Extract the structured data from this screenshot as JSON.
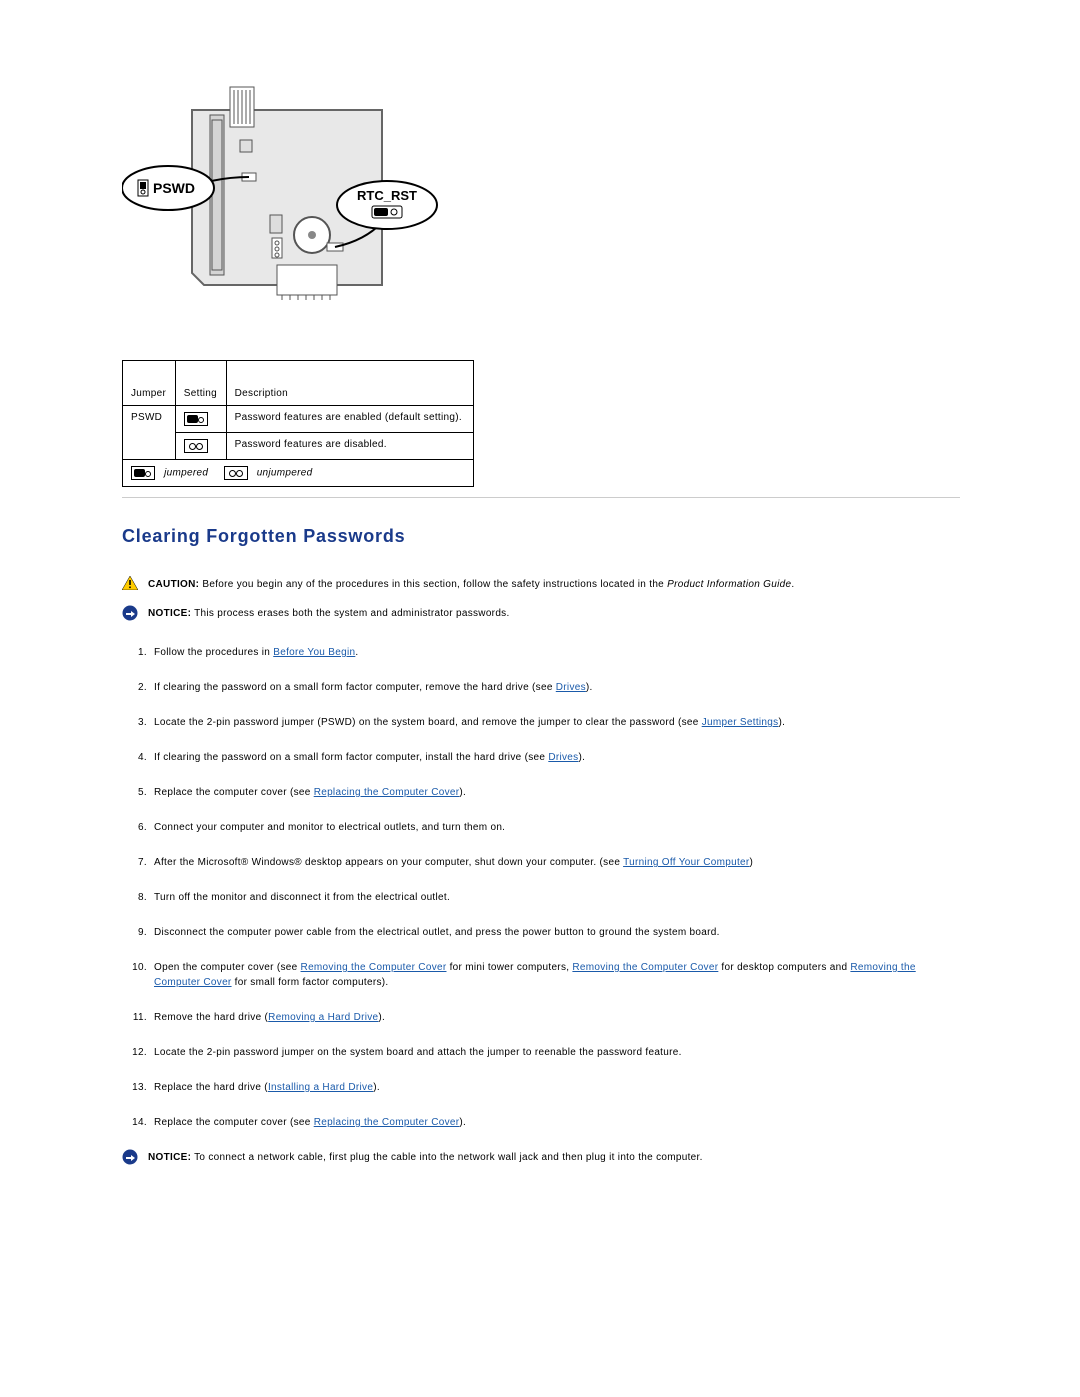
{
  "diagram": {
    "label_pswd": "PSWD",
    "label_rtcrst": "RTC_RST"
  },
  "table": {
    "headers": {
      "jumper": "Jumper",
      "setting": "Setting",
      "description": "Description"
    },
    "rows": [
      {
        "jumper": "PSWD",
        "setting_type": "jumpered",
        "description": "Password features are enabled (default setting)."
      },
      {
        "jumper": "",
        "setting_type": "unjumpered",
        "description": "Password features are disabled."
      }
    ],
    "legend": {
      "jumpered": "jumpered",
      "unjumpered": "unjumpered"
    }
  },
  "section_title": "Clearing Forgotten Passwords",
  "caution": {
    "label": "CAUTION:",
    "text_before": " Before you begin any of the procedures in this section, follow the safety instructions located in the ",
    "italic": "Product Information Guide",
    "text_after": "."
  },
  "notice1": {
    "label": "NOTICE:",
    "text": " This process erases both the system and administrator passwords."
  },
  "steps": [
    {
      "parts": [
        {
          "t": "Follow the procedures in "
        },
        {
          "link": "Before You Begin"
        },
        {
          "t": "."
        }
      ]
    },
    {
      "parts": [
        {
          "t": "If clearing the password on a small form factor computer, remove the hard drive (see "
        },
        {
          "link": "Drives"
        },
        {
          "t": ")."
        }
      ]
    },
    {
      "parts": [
        {
          "t": "Locate the 2-pin password jumper (PSWD) on the system board, and remove the jumper to clear the password (see "
        },
        {
          "link": "Jumper Settings"
        },
        {
          "t": ")."
        }
      ]
    },
    {
      "parts": [
        {
          "t": "If clearing the password on a small form factor computer, install the hard drive (see "
        },
        {
          "link": "Drives"
        },
        {
          "t": ")."
        }
      ]
    },
    {
      "parts": [
        {
          "t": "Replace the computer cover (see "
        },
        {
          "link": "Replacing the Computer Cover"
        },
        {
          "t": ")."
        }
      ]
    },
    {
      "parts": [
        {
          "t": "Connect your computer and monitor to electrical outlets, and turn them on."
        }
      ]
    },
    {
      "parts": [
        {
          "t": "After the Microsoft® Windows® desktop appears on your computer, shut down your computer. (see "
        },
        {
          "link": "Turning Off Your Computer"
        },
        {
          "t": ")"
        }
      ]
    },
    {
      "parts": [
        {
          "t": "Turn off the monitor and disconnect it from the electrical outlet."
        }
      ]
    },
    {
      "parts": [
        {
          "t": "Disconnect the computer power cable from the electrical outlet, and press the power button to ground the system board."
        }
      ]
    },
    {
      "parts": [
        {
          "t": "Open the computer cover (see "
        },
        {
          "link": "Removing the Computer Cover"
        },
        {
          "t": " for mini tower computers, "
        },
        {
          "link": "Removing the Computer Cover"
        },
        {
          "t": " for desktop computers and "
        },
        {
          "link": "Removing the Computer Cover"
        },
        {
          "t": " for small form factor computers)."
        }
      ]
    },
    {
      "parts": [
        {
          "t": "Remove the hard drive ("
        },
        {
          "link": "Removing a Hard Drive"
        },
        {
          "t": ")."
        }
      ]
    },
    {
      "parts": [
        {
          "t": "Locate the 2-pin password jumper on the system board and attach the jumper to reenable the password feature."
        }
      ]
    },
    {
      "parts": [
        {
          "t": "Replace the hard drive ("
        },
        {
          "link": "Installing a Hard Drive"
        },
        {
          "t": ")."
        }
      ]
    },
    {
      "parts": [
        {
          "t": "Replace the computer cover (see "
        },
        {
          "link": "Replacing the Computer Cover"
        },
        {
          "t": ")."
        }
      ]
    }
  ],
  "notice2": {
    "label": "NOTICE:",
    "text": " To connect a network cable, first plug the cable into the network wall jack and then plug it into the computer."
  }
}
